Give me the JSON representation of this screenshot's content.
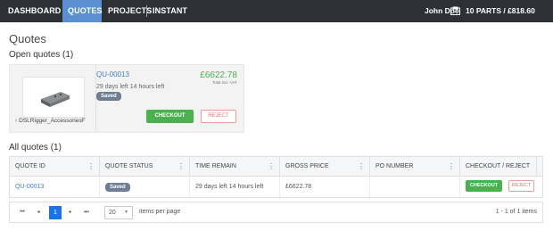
{
  "nav": {
    "items": [
      {
        "label": "DASHBOARD",
        "active": false
      },
      {
        "label": "QUOTES",
        "active": true
      },
      {
        "label": "PROJECTS",
        "active": false
      },
      {
        "label": "INSTANT QUOTE",
        "active": false
      }
    ],
    "user": "John Doe",
    "cart": "10 PARTS / £818.60",
    "active_color": "#5b8fd1"
  },
  "page": {
    "title": "Quotes",
    "open_title": "Open quotes (1)",
    "all_title": "All quotes (1)"
  },
  "open_quote": {
    "thumb_caption": "DSLRigger_AccessoriesF",
    "id": "QU-00013",
    "time_left": "29 days left 14 hours left",
    "status": "Saved",
    "price": "£6622.78",
    "price_note": "Total incl. VAT",
    "checkout": "CHECKOUT",
    "reject": "REJECT"
  },
  "table": {
    "headers": [
      "QUOTE ID",
      "QUOTE STATUS",
      "TIME REMAIN",
      "GROSS PRICE",
      "PO NUMBER",
      "CHECKOUT / REJECT"
    ],
    "rows": [
      {
        "id": "QU-00013",
        "status": "Saved",
        "time": "29 days left 14 hours left",
        "price": "£6622.78",
        "po": "",
        "checkout": "CHECKOUT",
        "reject": "REJECT"
      }
    ]
  },
  "pager": {
    "current_page": "1",
    "per_page": "20",
    "per_page_label": "items per page",
    "info": "1 - 1 of 1 items"
  },
  "colors": {
    "accent": "#1a73e8",
    "success": "#4caf50",
    "danger": "#e57373",
    "link": "#3f7fbf",
    "nav_bg": "#2d3136"
  },
  "icons": [
    "cart-icon",
    "first-page-icon",
    "prev-page-icon",
    "next-page-icon",
    "last-page-icon",
    "column-menu-icon",
    "chevron-left-icon",
    "chevron-right-icon"
  ]
}
